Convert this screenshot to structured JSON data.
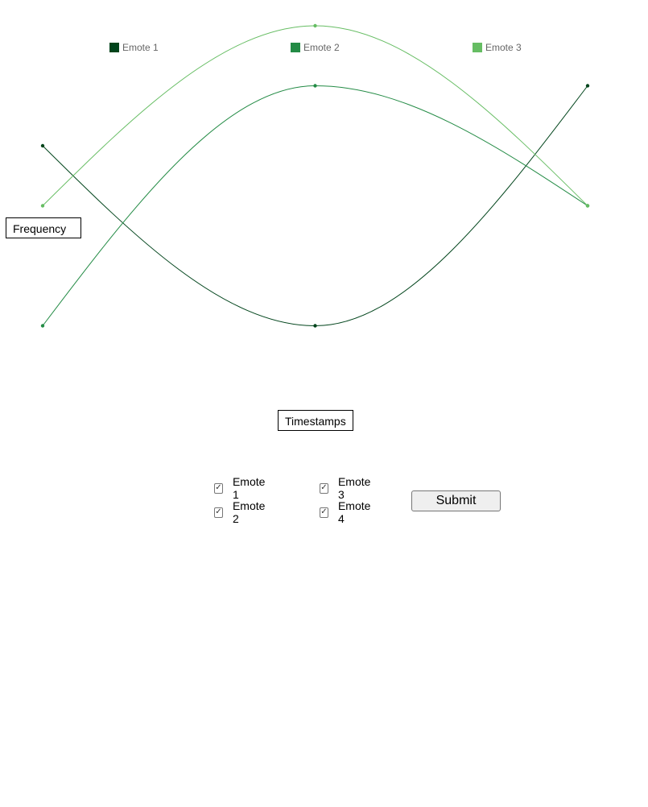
{
  "chart_data": {
    "type": "line",
    "xlabel": "Timestamps",
    "ylabel": "Frequency",
    "grid": false,
    "legend_position": "top",
    "curve": "smooth",
    "categories": [
      "",
      "",
      ""
    ],
    "ylim": [
      0,
      6
    ],
    "series": [
      {
        "name": "Emote 1",
        "color": "#00441b",
        "values": [
          4,
          1,
          5
        ]
      },
      {
        "name": "Emote 2",
        "color": "#238b45",
        "values": [
          1,
          5,
          3
        ]
      },
      {
        "name": "Emote 3",
        "color": "#66bd63",
        "values": [
          3,
          6,
          3
        ]
      }
    ]
  },
  "controls": {
    "checkboxes": [
      {
        "label": "Emote 1",
        "checked": true
      },
      {
        "label": "Emote 2",
        "checked": true
      },
      {
        "label": "Emote 3",
        "checked": true
      },
      {
        "label": "Emote 4",
        "checked": true
      }
    ],
    "submit_label": "Submit",
    "check_glyph": "✓"
  }
}
